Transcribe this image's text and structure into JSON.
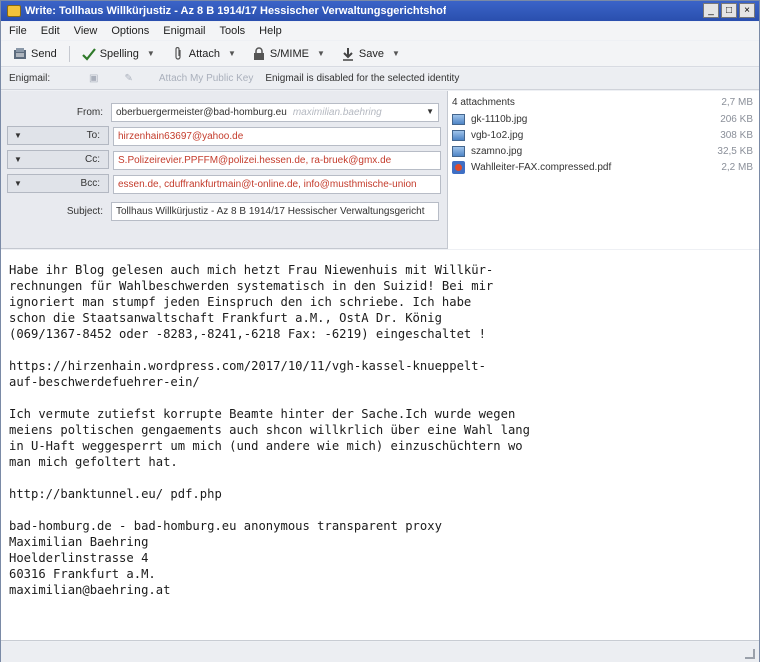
{
  "window": {
    "title": "Write: Tollhaus Willkürjustiz - Az 8 B 1914/17 Hessischer Verwaltungsgerichtshof",
    "controls": [
      "_",
      "□",
      "×"
    ]
  },
  "menu": [
    "File",
    "Edit",
    "View",
    "Options",
    "Enigmail",
    "Tools",
    "Help"
  ],
  "toolbar": {
    "send": "Send",
    "spelling": "Spelling",
    "attach": "Attach",
    "smime": "S/MIME",
    "save": "Save"
  },
  "enigmail": {
    "label": "Enigmail:",
    "attach_key": "Attach My Public Key",
    "status": "Enigmail is disabled for the selected identity"
  },
  "headers": {
    "from_label": "From:",
    "from_value": "oberbuergermeister@bad-homburg.eu",
    "from_identity": "maximilian.baehring",
    "to_label": "To:",
    "to_value": "hirzenhain63697@yahoo.de",
    "cc_label": "Cc:",
    "cc_value": "S.Polizeirevier.PPFFM@polizei.hessen.de, ra-bruek@gmx.de",
    "bcc_label": "Bcc:",
    "bcc_value": "essen.de, cduffrankfurtmain@t-online.de, info@musthmische-union",
    "subject_label": "Subject:",
    "subject_value": "Tollhaus Willkürjustiz - Az 8 B 1914/17 Hessischer Verwaltungsgericht"
  },
  "attachments": {
    "header": "4 attachments",
    "total_size": "2,7 MB",
    "items": [
      {
        "name": "gk-1110b.jpg",
        "size": "206 KB",
        "icon": "image-icon"
      },
      {
        "name": "vgb-1o2.jpg",
        "size": "308 KB",
        "icon": "image-icon"
      },
      {
        "name": "szamno.jpg",
        "size": "32,5 KB",
        "icon": "image-icon"
      },
      {
        "name": "Wahlleiter-FAX.compressed.pdf",
        "size": "2,2 MB",
        "icon": "pdf-icon"
      }
    ]
  },
  "body": "Habe ihr Blog gelesen auch mich hetzt Frau Niewenhuis mit Willkür-\nrechnungen für Wahlbeschwerden systematisch in den Suizid! Bei mir\nignoriert man stumpf jeden Einspruch den ich schriebe. Ich habe\nschon die Staatsanwaltschaft Frankfurt a.M., OstA Dr. König\n(069/1367-8452 oder -8283,-8241,-6218 Fax: -6219) eingeschaltet !\n\nhttps://hirzenhain.wordpress.com/2017/10/11/vgh-kassel-knueppelt-\nauf-beschwerdefuehrer-ein/\n\nIch vermute zutiefst korrupte Beamte hinter der Sache.Ich wurde wegen\nmeiens poltischen gengaements auch shcon willkrlich über eine Wahl lang\nin U-Haft weggesperrt um mich (und andere wie mich) einzuschüchtern wo\nman mich gefoltert hat.\n\nhttp://banktunnel.eu/ pdf.php\n\nbad-homburg.de - bad-homburg.eu anonymous transparent proxy\nMaximilian Baehring\nHoelderlinstrasse 4\n60316 Frankfurt a.M.\nmaximilian@baehring.at",
  "colors": {
    "titlebar": "#2a4fae",
    "recipient_text": "#c43c2c"
  }
}
